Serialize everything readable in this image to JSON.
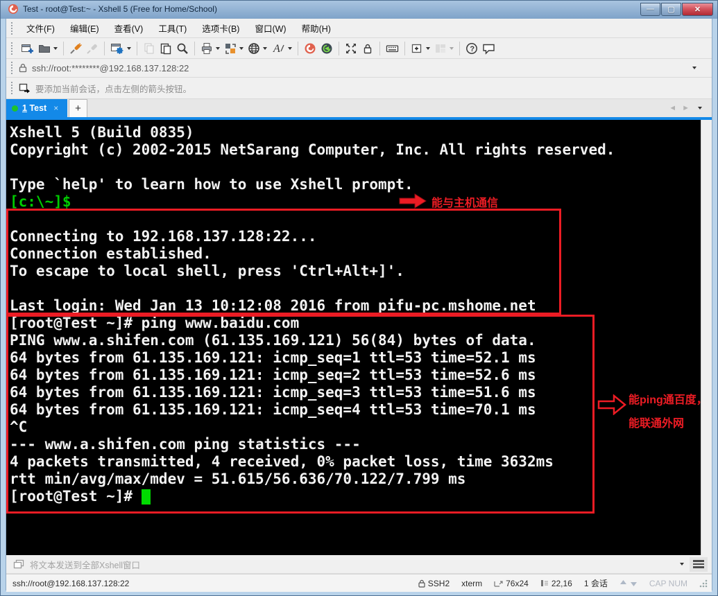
{
  "window": {
    "title": "Test - root@Test:~ - Xshell 5 (Free for Home/School)"
  },
  "titlebar_buttons": {
    "minimize": "—",
    "maximize": "▢",
    "close": "✕"
  },
  "menu": {
    "items": [
      "文件(F)",
      "编辑(E)",
      "查看(V)",
      "工具(T)",
      "选项卡(B)",
      "窗口(W)",
      "帮助(H)"
    ]
  },
  "toolbar": {
    "icons": [
      "new-session-icon",
      "open-session-icon",
      "connect-icon",
      "disconnect-icon",
      "properties-icon",
      "copy-icon",
      "paste-icon",
      "find-icon",
      "print-icon",
      "transfer-icon",
      "web-icon",
      "font-icon",
      "xshell-icon",
      "xftp-icon",
      "fullscreen-icon",
      "lock-screen-icon",
      "virtual-keyboard-icon",
      "new-window-icon",
      "tile-windows-icon",
      "help-icon",
      "feedback-icon"
    ]
  },
  "addressbar": {
    "value": "ssh://root:********@192.168.137.128:22"
  },
  "sessionbar": {
    "hint": "要添加当前会话，点击左侧的箭头按钮。"
  },
  "tabs": {
    "index": "1",
    "label": "Test",
    "close": "×",
    "new_tab": "+",
    "nav_prev": "◄",
    "nav_next": "►"
  },
  "terminal": {
    "lines": [
      [
        {
          "t": "Xshell 5 (Build 0835)",
          "c": "w"
        }
      ],
      [
        {
          "t": "Copyright (c) 2002-2015 NetSarang Computer, Inc. All rights reserved.",
          "c": "w"
        }
      ],
      [],
      [
        {
          "t": "Type `help' to learn how to use Xshell prompt.",
          "c": "w"
        }
      ],
      [
        {
          "t": "[c:\\~]$",
          "c": "g"
        }
      ],
      [],
      [
        {
          "t": "Connecting to 192.168.137.128:22...",
          "c": "w"
        }
      ],
      [
        {
          "t": "Connection established.",
          "c": "w"
        }
      ],
      [
        {
          "t": "To escape to local shell, press 'Ctrl+Alt+]'.",
          "c": "w"
        }
      ],
      [],
      [
        {
          "t": "Last login: Wed Jan 13 10:12:08 2016 from pifu-pc.mshome.net",
          "c": "w"
        }
      ],
      [
        {
          "t": "[root@Test ~]# ping www.baidu.com",
          "c": "w"
        }
      ],
      [
        {
          "t": "PING www.a.shifen.com (61.135.169.121) 56(84) bytes of data.",
          "c": "w"
        }
      ],
      [
        {
          "t": "64 bytes from 61.135.169.121: icmp_seq=1 ttl=53 time=52.1 ms",
          "c": "w"
        }
      ],
      [
        {
          "t": "64 bytes from 61.135.169.121: icmp_seq=2 ttl=53 time=52.6 ms",
          "c": "w"
        }
      ],
      [
        {
          "t": "64 bytes from 61.135.169.121: icmp_seq=3 ttl=53 time=51.6 ms",
          "c": "w"
        }
      ],
      [
        {
          "t": "64 bytes from 61.135.169.121: icmp_seq=4 ttl=53 time=70.1 ms",
          "c": "w"
        }
      ],
      [
        {
          "t": "^C",
          "c": "w"
        }
      ],
      [
        {
          "t": "--- www.a.shifen.com ping statistics ---",
          "c": "w"
        }
      ],
      [
        {
          "t": "4 packets transmitted, 4 received, 0% packet loss, time 3632ms",
          "c": "w"
        }
      ],
      [
        {
          "t": "rtt min/avg/max/mdev = 51.615/56.636/70.122/7.799 ms",
          "c": "w"
        }
      ],
      [
        {
          "t": "[root@Test ~]# ",
          "c": "w"
        },
        {
          "t": " ",
          "c": "cursor"
        }
      ]
    ],
    "annotations": {
      "host": {
        "text": "能与主机通信"
      },
      "ping": {
        "line1": "能ping通百度，",
        "line2": "能联通外网"
      }
    },
    "accent_red": "#ec1c24",
    "prompt_green": "#00cb00"
  },
  "sendbar": {
    "label": "将文本发送到全部Xshell窗口"
  },
  "statusbar": {
    "address": "ssh://root@192.168.137.128:22",
    "protocol": "SSH2",
    "terminal_type": "xterm",
    "grid_size": "76x24",
    "cursor_position": "22,16",
    "session_count": "1 会话",
    "lock_indicators": "CAP NUM"
  }
}
